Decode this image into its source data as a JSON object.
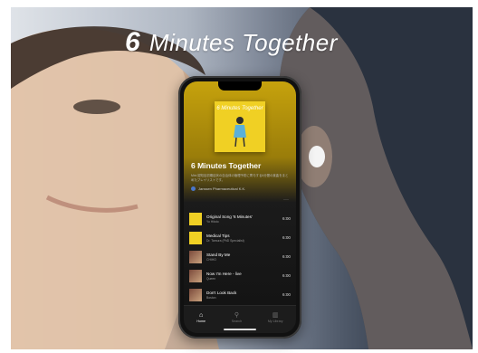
{
  "brand": {
    "logo_mark": "6",
    "text": "Minutes Together"
  },
  "app": {
    "cover_title": "6 Minutes Together",
    "playlist_title": "6 Minutes Together",
    "description": "Mini 認知症初期症状の自治体の管理予防に寄与する6分間の楽曲をまとめたプレイリストです。",
    "owner": "Janssen Pharmaceutical K.K.",
    "more_label": "···",
    "tracks": [
      {
        "title": "Original Song '6 Minutes'",
        "artist": "Yo Hitoto",
        "duration": "6:00",
        "thumb": "y"
      },
      {
        "title": "Medical Tips",
        "artist": "Dr. Tamura (PhD Specialist)",
        "duration": "6:00",
        "thumb": "y"
      },
      {
        "title": "Stand By Me",
        "artist": "CHIHO",
        "duration": "6:00",
        "thumb": "p"
      },
      {
        "title": "Now I'm Here - live",
        "artist": "Queen",
        "duration": "6:00",
        "thumb": "p"
      },
      {
        "title": "Don't Look Back",
        "artist": "Boston",
        "duration": "6:00",
        "thumb": "p"
      }
    ],
    "tabs": [
      {
        "label": "Home",
        "icon": "home-icon",
        "active": true
      },
      {
        "label": "Search",
        "icon": "search-icon",
        "active": false
      },
      {
        "label": "My Library",
        "icon": "library-icon",
        "active": false
      }
    ]
  },
  "colors": {
    "accent": "#f0d024",
    "background": "#121212"
  }
}
